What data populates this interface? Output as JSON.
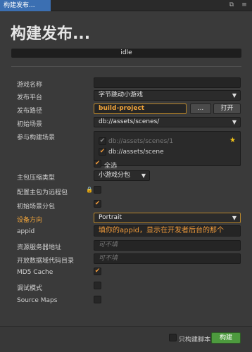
{
  "tab": {
    "label": "构建发布..."
  },
  "page_title": "构建发布...",
  "status": "idle",
  "form": {
    "game_name_label": "游戏名称",
    "game_name_value": "",
    "platform_label": "发布平台",
    "platform_value": "字节跳动小游戏",
    "path_label": "发布路径",
    "path_value": "build-project",
    "path_browse_label": "...",
    "path_open_label": "打开",
    "start_scene_label": "初始场景",
    "start_scene_value": "db://assets/scenes/",
    "scenes_label": "参与构建场景",
    "scenes": [
      {
        "path": "db://assets/scenes/1",
        "checked": true,
        "dim": true
      },
      {
        "path": "db://assets/scene",
        "checked": true,
        "dim": false
      }
    ],
    "select_all_label": "全选",
    "compression_label": "主包压缩类型",
    "compression_value": "小游戏分包",
    "remote_label": "配置主包为远程包",
    "subpackage_label": "初始场景分包",
    "orientation_label": "设备方向",
    "orientation_value": "Portrait",
    "appid_label": "appid",
    "appid_value": "填你的appid，显示在开发者后台的那个",
    "server_label": "资源服务器地址",
    "server_placeholder": "可不填",
    "opendata_label": "开放数据域代码目录",
    "opendata_placeholder": "可不填",
    "md5_label": "MD5 Cache",
    "debug_label": "调试模式",
    "sourcemap_label": "Source Maps"
  },
  "footer": {
    "build_script_only_label": "只构建脚本",
    "build_label": "构建"
  },
  "colors": {
    "accent": "#f0a43a",
    "build": "#4d9a3e",
    "tab": "#3b6fb2"
  }
}
